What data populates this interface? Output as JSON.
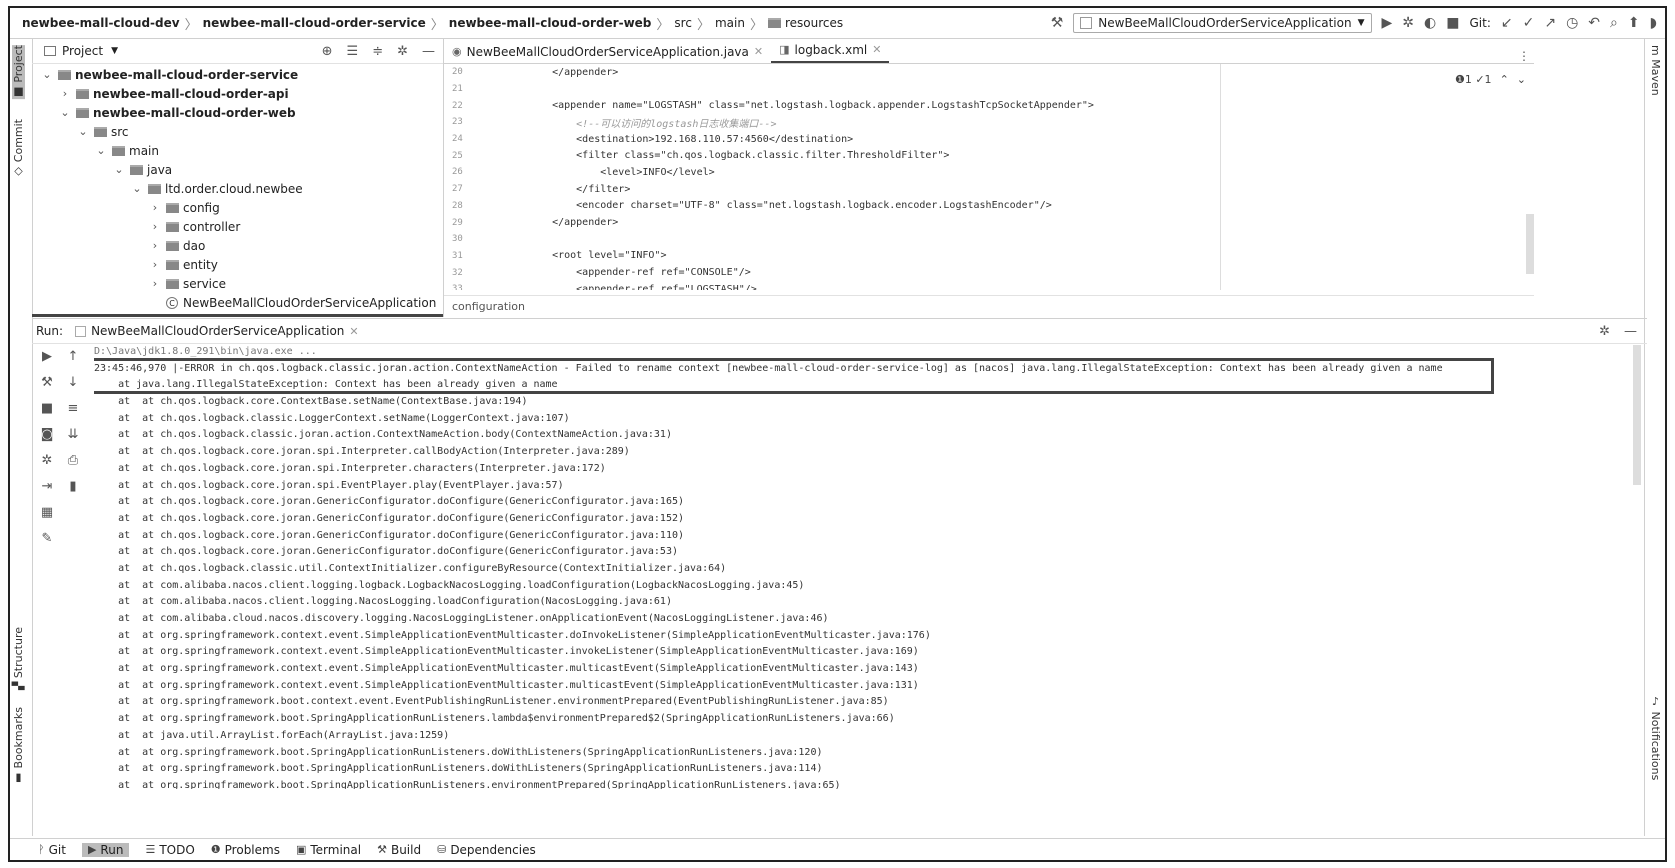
{
  "breadcrumbs": [
    {
      "label": "newbee-mall-cloud-dev",
      "bold": true,
      "icon": ""
    },
    {
      "label": "newbee-mall-cloud-order-service",
      "bold": true,
      "icon": ""
    },
    {
      "label": "newbee-mall-cloud-order-web",
      "bold": true,
      "icon": ""
    },
    {
      "label": "src",
      "bold": false,
      "icon": ""
    },
    {
      "label": "main",
      "bold": false,
      "icon": ""
    },
    {
      "label": "resources",
      "bold": false,
      "icon": "folder-icon"
    }
  ],
  "toolbar": {
    "run_config": "NewBeeMallCloudOrderServiceApplication",
    "git_label": "Git:"
  },
  "left_strip": {
    "project": "Project",
    "commit": "Commit",
    "structure": "Structure",
    "bookmarks": "Bookmarks"
  },
  "right_strip": {
    "maven": "Maven",
    "notifications": "Notifications"
  },
  "project_panel": {
    "title": "Project",
    "tree": [
      {
        "label": "newbee-mall-cloud-order-service",
        "depth": 1,
        "chevron": "down",
        "bold": true,
        "icon": "module"
      },
      {
        "label": "newbee-mall-cloud-order-api",
        "depth": 2,
        "chevron": "right",
        "bold": true,
        "icon": "module"
      },
      {
        "label": "newbee-mall-cloud-order-web",
        "depth": 2,
        "chevron": "down",
        "bold": true,
        "icon": "module"
      },
      {
        "label": "src",
        "depth": 3,
        "chevron": "down",
        "bold": false,
        "icon": "folder"
      },
      {
        "label": "main",
        "depth": 4,
        "chevron": "down",
        "bold": false,
        "icon": "folder"
      },
      {
        "label": "java",
        "depth": 5,
        "chevron": "down",
        "bold": false,
        "icon": "folder"
      },
      {
        "label": "ltd.order.cloud.newbee",
        "depth": 6,
        "chevron": "down",
        "bold": false,
        "icon": "package"
      },
      {
        "label": "config",
        "depth": 7,
        "chevron": "right",
        "bold": false,
        "icon": "package"
      },
      {
        "label": "controller",
        "depth": 7,
        "chevron": "right",
        "bold": false,
        "icon": "package"
      },
      {
        "label": "dao",
        "depth": 7,
        "chevron": "right",
        "bold": false,
        "icon": "package"
      },
      {
        "label": "entity",
        "depth": 7,
        "chevron": "right",
        "bold": false,
        "icon": "package"
      },
      {
        "label": "service",
        "depth": 7,
        "chevron": "right",
        "bold": false,
        "icon": "package"
      },
      {
        "label": "NewBeeMallCloudOrderServiceApplication",
        "depth": 7,
        "chevron": "none",
        "bold": false,
        "icon": "class"
      }
    ]
  },
  "editor": {
    "tabs": [
      {
        "label": "NewBeeMallCloudOrderServiceApplication.java",
        "active": false
      },
      {
        "label": "logback.xml",
        "active": true
      }
    ],
    "lines": [
      {
        "num": "20",
        "text": "    </appender>",
        "comment": false
      },
      {
        "num": "21",
        "text": "",
        "comment": false
      },
      {
        "num": "22",
        "text": "    <appender name=\"LOGSTASH\" class=\"net.logstash.logback.appender.LogstashTcpSocketAppender\">",
        "comment": false
      },
      {
        "num": "23",
        "text": "        <!--可以访问的logstash日志收集端口-->",
        "comment": true
      },
      {
        "num": "24",
        "text": "        <destination>192.168.110.57:4560</destination>",
        "comment": false
      },
      {
        "num": "25",
        "text": "        <filter class=\"ch.qos.logback.classic.filter.ThresholdFilter\">",
        "comment": false
      },
      {
        "num": "26",
        "text": "            <level>INFO</level>",
        "comment": false
      },
      {
        "num": "27",
        "text": "        </filter>",
        "comment": false
      },
      {
        "num": "28",
        "text": "        <encoder charset=\"UTF-8\" class=\"net.logstash.logback.encoder.LogstashEncoder\"/>",
        "comment": false
      },
      {
        "num": "29",
        "text": "    </appender>",
        "comment": false
      },
      {
        "num": "30",
        "text": "",
        "comment": false
      },
      {
        "num": "31",
        "text": "    <root level=\"INFO\">",
        "comment": false
      },
      {
        "num": "32",
        "text": "        <appender-ref ref=\"CONSOLE\"/>",
        "comment": false
      },
      {
        "num": "33",
        "text": "        <appender-ref ref=\"LOGSTASH\"/>",
        "comment": false
      }
    ],
    "inspection_badge": "❶1 ✓1",
    "breadcrumb": "configuration"
  },
  "run_panel": {
    "label": "Run:",
    "tab": "NewBeeMallCloudOrderServiceApplication",
    "output": [
      "D:\\Java\\jdk1.8.0_291\\bin\\java.exe ...",
      "23:45:46,970 |-ERROR in ch.qos.logback.classic.joran.action.ContextNameAction - Failed to rename context [newbee-mall-cloud-order-service-log] as [nacos] java.lang.IllegalStateException: Context has been already given a name",
      "    at java.lang.IllegalStateException: Context has been already given a name",
      "    at  at ch.qos.logback.core.ContextBase.setName(ContextBase.java:194)",
      "    at  at ch.qos.logback.classic.LoggerContext.setName(LoggerContext.java:107)",
      "    at  at ch.qos.logback.classic.joran.action.ContextNameAction.body(ContextNameAction.java:31)",
      "    at  at ch.qos.logback.core.joran.spi.Interpreter.callBodyAction(Interpreter.java:289)",
      "    at  at ch.qos.logback.core.joran.spi.Interpreter.characters(Interpreter.java:172)",
      "    at  at ch.qos.logback.core.joran.spi.EventPlayer.play(EventPlayer.java:57)",
      "    at  at ch.qos.logback.core.joran.GenericConfigurator.doConfigure(GenericConfigurator.java:165)",
      "    at  at ch.qos.logback.core.joran.GenericConfigurator.doConfigure(GenericConfigurator.java:152)",
      "    at  at ch.qos.logback.core.joran.GenericConfigurator.doConfigure(GenericConfigurator.java:110)",
      "    at  at ch.qos.logback.core.joran.GenericConfigurator.doConfigure(GenericConfigurator.java:53)",
      "    at  at ch.qos.logback.classic.util.ContextInitializer.configureByResource(ContextInitializer.java:64)",
      "    at  at com.alibaba.nacos.client.logging.logback.LogbackNacosLogging.loadConfiguration(LogbackNacosLogging.java:45)",
      "    at  at com.alibaba.nacos.client.logging.NacosLogging.loadConfiguration(NacosLogging.java:61)",
      "    at  at com.alibaba.cloud.nacos.discovery.logging.NacosLoggingListener.onApplicationEvent(NacosLoggingListener.java:46)",
      "    at  at org.springframework.context.event.SimpleApplicationEventMulticaster.doInvokeListener(SimpleApplicationEventMulticaster.java:176)",
      "    at  at org.springframework.context.event.SimpleApplicationEventMulticaster.invokeListener(SimpleApplicationEventMulticaster.java:169)",
      "    at  at org.springframework.context.event.SimpleApplicationEventMulticaster.multicastEvent(SimpleApplicationEventMulticaster.java:143)",
      "    at  at org.springframework.context.event.SimpleApplicationEventMulticaster.multicastEvent(SimpleApplicationEventMulticaster.java:131)",
      "    at  at org.springframework.boot.context.event.EventPublishingRunListener.environmentPrepared(EventPublishingRunListener.java:85)",
      "    at  at org.springframework.boot.SpringApplicationRunListeners.lambda$environmentPrepared$2(SpringApplicationRunListeners.java:66)",
      "    at  at java.util.ArrayList.forEach(ArrayList.java:1259)",
      "    at  at org.springframework.boot.SpringApplicationRunListeners.doWithListeners(SpringApplicationRunListeners.java:120)",
      "    at  at org.springframework.boot.SpringApplicationRunListeners.doWithListeners(SpringApplicationRunListeners.java:114)",
      "    at  at org.springframework.boot.SpringApplicationRunListeners.environmentPrepared(SpringApplicationRunListeners.java:65)"
    ]
  },
  "bottom_bar": [
    {
      "label": "Git",
      "icon": "git-branch-icon",
      "glyph": "ᚹ",
      "active": false
    },
    {
      "label": "Run",
      "icon": "run-icon",
      "glyph": "▶",
      "active": true
    },
    {
      "label": "TODO",
      "icon": "todo-icon",
      "glyph": "☰",
      "active": false
    },
    {
      "label": "Problems",
      "icon": "problems-icon",
      "glyph": "❶",
      "active": false
    },
    {
      "label": "Terminal",
      "icon": "terminal-icon",
      "glyph": "▣",
      "active": false
    },
    {
      "label": "Build",
      "icon": "build-icon",
      "glyph": "⚒",
      "active": false
    },
    {
      "label": "Dependencies",
      "icon": "dependencies-icon",
      "glyph": "⛁",
      "active": false
    }
  ]
}
